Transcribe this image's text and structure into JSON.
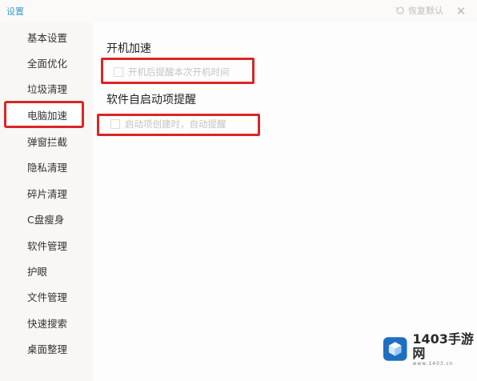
{
  "window": {
    "title": "设置",
    "restore_default_label": "恢复默认",
    "close_icon": "close-icon"
  },
  "sidebar": {
    "items": [
      {
        "label": "基本设置"
      },
      {
        "label": "全面优化"
      },
      {
        "label": "垃圾清理"
      },
      {
        "label": "电脑加速",
        "active": true
      },
      {
        "label": "弹窗拦截"
      },
      {
        "label": "隐私清理"
      },
      {
        "label": "碎片清理"
      },
      {
        "label": "C盘瘦身"
      },
      {
        "label": "软件管理"
      },
      {
        "label": "护眼"
      },
      {
        "label": "文件管理"
      },
      {
        "label": "快速搜索"
      },
      {
        "label": "桌面整理"
      }
    ]
  },
  "main": {
    "sections": [
      {
        "title": "开机加速",
        "option": {
          "label": "开机后提醒本次开机时间",
          "checked": false
        }
      },
      {
        "title": "软件自启动项提醒",
        "option": {
          "label": "启动项创建时，自动提醒",
          "checked": false
        }
      }
    ]
  },
  "watermark": {
    "text": "1403手游网",
    "sub": "www.1403.cn"
  },
  "colors": {
    "accent": "#3c9bd6",
    "highlight": "#d92626",
    "sidebar_bg": "#f8f7f4"
  }
}
